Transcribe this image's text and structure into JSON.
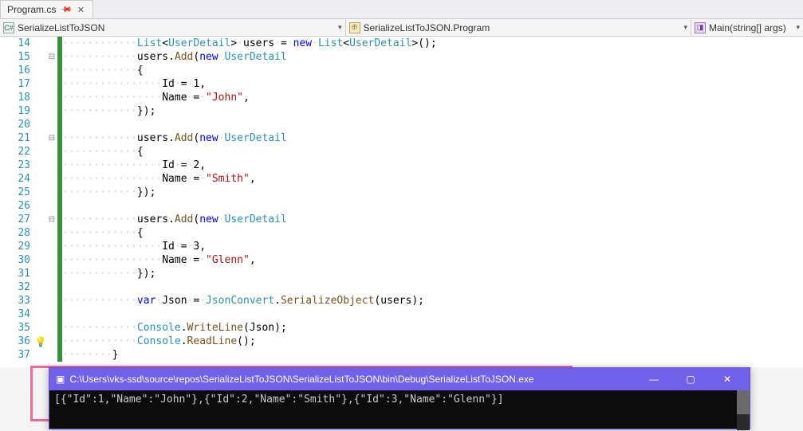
{
  "tab": {
    "title": "Program.cs"
  },
  "nav": {
    "ns": "SerializeListToJSON",
    "cls": "SerializeListToJSON.Program",
    "member": "Main(string[] args)"
  },
  "code": {
    "lines": [
      {
        "n": 14,
        "fold": "",
        "glyph": "",
        "segs": [
          [
            "ws",
            "············"
          ],
          [
            "ty",
            "List"
          ],
          [
            "op",
            "<"
          ],
          [
            "ty",
            "UserDetail"
          ],
          [
            "op",
            ">"
          ],
          [
            "ws",
            "·"
          ],
          [
            "id",
            "users"
          ],
          [
            "ws",
            "·"
          ],
          [
            "op",
            "="
          ],
          [
            "ws",
            "·"
          ],
          [
            "kw",
            "new"
          ],
          [
            "ws",
            "·"
          ],
          [
            "ty",
            "List"
          ],
          [
            "op",
            "<"
          ],
          [
            "ty",
            "UserDetail"
          ],
          [
            "op",
            "></"
          ],
          [
            "op",
            ">();"
          ]
        ]
      },
      {
        "n": 15,
        "fold": "-",
        "glyph": "",
        "segs": [
          [
            "ws",
            "············"
          ],
          [
            "id",
            "users"
          ],
          [
            "op",
            "."
          ],
          [
            "mtd",
            "Add"
          ],
          [
            "op",
            "("
          ],
          [
            "kw",
            "new"
          ],
          [
            "ws",
            "·"
          ],
          [
            "ty",
            "UserDetail"
          ]
        ]
      },
      {
        "n": 16,
        "fold": "",
        "glyph": "",
        "segs": [
          [
            "ws",
            "············"
          ],
          [
            "op",
            "{"
          ]
        ]
      },
      {
        "n": 17,
        "fold": "",
        "glyph": "",
        "segs": [
          [
            "ws",
            "················"
          ],
          [
            "id",
            "Id"
          ],
          [
            "ws",
            "·"
          ],
          [
            "op",
            "="
          ],
          [
            "ws",
            "·"
          ],
          [
            "num",
            "1"
          ],
          [
            "op",
            ","
          ]
        ]
      },
      {
        "n": 18,
        "fold": "",
        "glyph": "",
        "segs": [
          [
            "ws",
            "················"
          ],
          [
            "id",
            "Name"
          ],
          [
            "ws",
            "·"
          ],
          [
            "op",
            "="
          ],
          [
            "ws",
            "·"
          ],
          [
            "st",
            "\"John\""
          ],
          [
            "op",
            ","
          ]
        ]
      },
      {
        "n": 19,
        "fold": "",
        "glyph": "",
        "segs": [
          [
            "ws",
            "············"
          ],
          [
            "op",
            "});"
          ]
        ]
      },
      {
        "n": 20,
        "fold": "",
        "glyph": "",
        "segs": []
      },
      {
        "n": 21,
        "fold": "-",
        "glyph": "",
        "segs": [
          [
            "ws",
            "············"
          ],
          [
            "id",
            "users"
          ],
          [
            "op",
            "."
          ],
          [
            "mtd",
            "Add"
          ],
          [
            "op",
            "("
          ],
          [
            "kw",
            "new"
          ],
          [
            "ws",
            "·"
          ],
          [
            "ty",
            "UserDetail"
          ]
        ]
      },
      {
        "n": 22,
        "fold": "",
        "glyph": "",
        "segs": [
          [
            "ws",
            "············"
          ],
          [
            "op",
            "{"
          ]
        ]
      },
      {
        "n": 23,
        "fold": "",
        "glyph": "",
        "segs": [
          [
            "ws",
            "················"
          ],
          [
            "id",
            "Id"
          ],
          [
            "ws",
            "·"
          ],
          [
            "op",
            "="
          ],
          [
            "ws",
            "·"
          ],
          [
            "num",
            "2"
          ],
          [
            "op",
            ","
          ]
        ]
      },
      {
        "n": 24,
        "fold": "",
        "glyph": "",
        "segs": [
          [
            "ws",
            "················"
          ],
          [
            "id",
            "Name"
          ],
          [
            "ws",
            "·"
          ],
          [
            "op",
            "="
          ],
          [
            "ws",
            "·"
          ],
          [
            "st",
            "\"Smith\""
          ],
          [
            "op",
            ","
          ]
        ]
      },
      {
        "n": 25,
        "fold": "",
        "glyph": "",
        "segs": [
          [
            "ws",
            "············"
          ],
          [
            "op",
            "});"
          ]
        ]
      },
      {
        "n": 26,
        "fold": "",
        "glyph": "",
        "segs": []
      },
      {
        "n": 27,
        "fold": "-",
        "glyph": "",
        "segs": [
          [
            "ws",
            "············"
          ],
          [
            "id",
            "users"
          ],
          [
            "op",
            "."
          ],
          [
            "mtd",
            "Add"
          ],
          [
            "op",
            "("
          ],
          [
            "kw",
            "new"
          ],
          [
            "ws",
            "·"
          ],
          [
            "ty",
            "UserDetail"
          ]
        ]
      },
      {
        "n": 28,
        "fold": "",
        "glyph": "",
        "segs": [
          [
            "ws",
            "············"
          ],
          [
            "op",
            "{"
          ]
        ]
      },
      {
        "n": 29,
        "fold": "",
        "glyph": "",
        "segs": [
          [
            "ws",
            "················"
          ],
          [
            "id",
            "Id"
          ],
          [
            "ws",
            "·"
          ],
          [
            "op",
            "="
          ],
          [
            "ws",
            "·"
          ],
          [
            "num",
            "3"
          ],
          [
            "op",
            ","
          ]
        ]
      },
      {
        "n": 30,
        "fold": "",
        "glyph": "",
        "segs": [
          [
            "ws",
            "················"
          ],
          [
            "id",
            "Name"
          ],
          [
            "ws",
            "·"
          ],
          [
            "op",
            "="
          ],
          [
            "ws",
            "·"
          ],
          [
            "st",
            "\"Glenn\""
          ],
          [
            "op",
            ","
          ]
        ]
      },
      {
        "n": 31,
        "fold": "",
        "glyph": "",
        "segs": [
          [
            "ws",
            "············"
          ],
          [
            "op",
            "});"
          ]
        ]
      },
      {
        "n": 32,
        "fold": "",
        "glyph": "",
        "segs": []
      },
      {
        "n": 33,
        "fold": "",
        "glyph": "",
        "segs": [
          [
            "ws",
            "············"
          ],
          [
            "kw",
            "var"
          ],
          [
            "ws",
            "·"
          ],
          [
            "id",
            "Json"
          ],
          [
            "ws",
            "·"
          ],
          [
            "op",
            "="
          ],
          [
            "ws",
            "·"
          ],
          [
            "ty",
            "JsonConvert"
          ],
          [
            "op",
            "."
          ],
          [
            "mtd",
            "SerializeObject"
          ],
          [
            "op",
            "("
          ],
          [
            "id",
            "users"
          ],
          [
            "op",
            ");"
          ]
        ]
      },
      {
        "n": 34,
        "fold": "",
        "glyph": "",
        "segs": []
      },
      {
        "n": 35,
        "fold": "",
        "glyph": "",
        "segs": [
          [
            "ws",
            "············"
          ],
          [
            "ty",
            "Console"
          ],
          [
            "op",
            "."
          ],
          [
            "mtd",
            "WriteLine"
          ],
          [
            "op",
            "("
          ],
          [
            "id",
            "Json"
          ],
          [
            "op",
            ");"
          ]
        ]
      },
      {
        "n": 36,
        "fold": "",
        "glyph": "bulb",
        "segs": [
          [
            "ws",
            "············"
          ],
          [
            "ty",
            "Console"
          ],
          [
            "op",
            "."
          ],
          [
            "mtd",
            "ReadLine"
          ],
          [
            "op",
            "();"
          ]
        ]
      },
      {
        "n": 37,
        "fold": "",
        "glyph": "",
        "segs": [
          [
            "ws",
            "········"
          ],
          [
            "op",
            "}"
          ]
        ]
      }
    ]
  },
  "console": {
    "title": "C:\\Users\\vks-ssd\\source\\repos\\SerializeListToJSON\\SerializeListToJSON\\bin\\Debug\\SerializeListToJSON.exe",
    "output": "[{\"Id\":1,\"Name\":\"John\"},{\"Id\":2,\"Name\":\"Smith\"},{\"Id\":3,\"Name\":\"Glenn\"}]"
  }
}
